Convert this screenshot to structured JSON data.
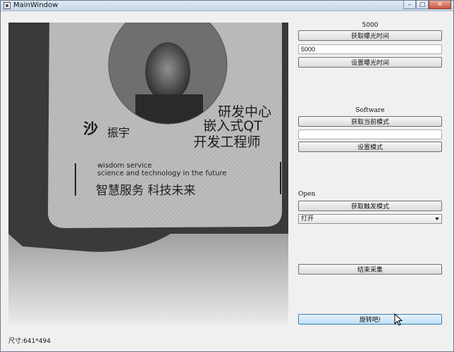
{
  "window": {
    "title": "MainWindow"
  },
  "exposure": {
    "value_label": "5000",
    "get_button": "获取曝光时间",
    "input_value": "5000",
    "set_button": "设置曝光时间"
  },
  "mode": {
    "value_label": "Software",
    "get_button": "获取当前模式",
    "input_value": "",
    "set_button": "设置模式"
  },
  "trigger": {
    "value_label": "Open",
    "get_button": "获取触发模式",
    "select_value": "打开"
  },
  "stop_button": "结束采集",
  "rotate_button": "旋转吧!",
  "status": "尺寸:641*494",
  "card": {
    "dept": "研发中心",
    "role_line1": "嵌入式QT",
    "role_line2": "开发工程师",
    "surname": "沙",
    "given_name": "振宇",
    "slogan_en_1": "wisdom service",
    "slogan_en_2": "science and technology in the future",
    "slogan_cn": "智慧服务  科技未来"
  }
}
